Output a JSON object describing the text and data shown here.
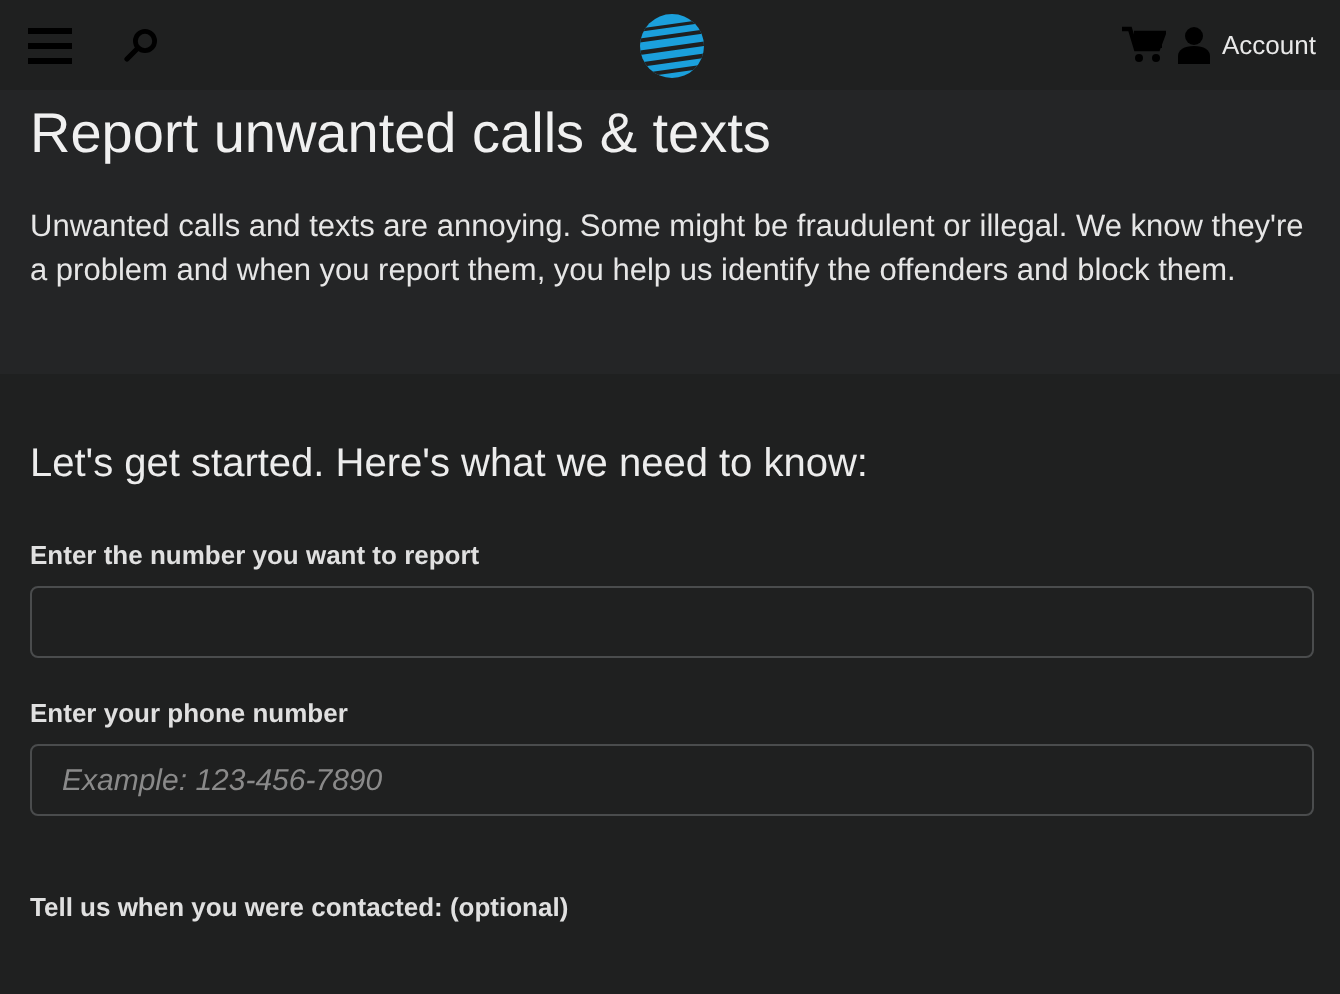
{
  "header": {
    "account_label": "Account"
  },
  "hero": {
    "title": "Report unwanted calls & texts",
    "description": "Unwanted calls and texts are annoying. Some might be fraudulent or illegal. We know they're a problem and when you report them, you help us identify the offenders and block them."
  },
  "form": {
    "heading": "Let's get started. Here's what we need to know:",
    "fields": [
      {
        "kind": "input",
        "label": "Enter the number you want to report"
      },
      {
        "kind": "input",
        "label": "Enter your phone number",
        "placeholder": "Example: 123-456-7890"
      },
      {
        "kind": "label",
        "label": "Tell us when you were contacted: (optional)"
      }
    ]
  }
}
